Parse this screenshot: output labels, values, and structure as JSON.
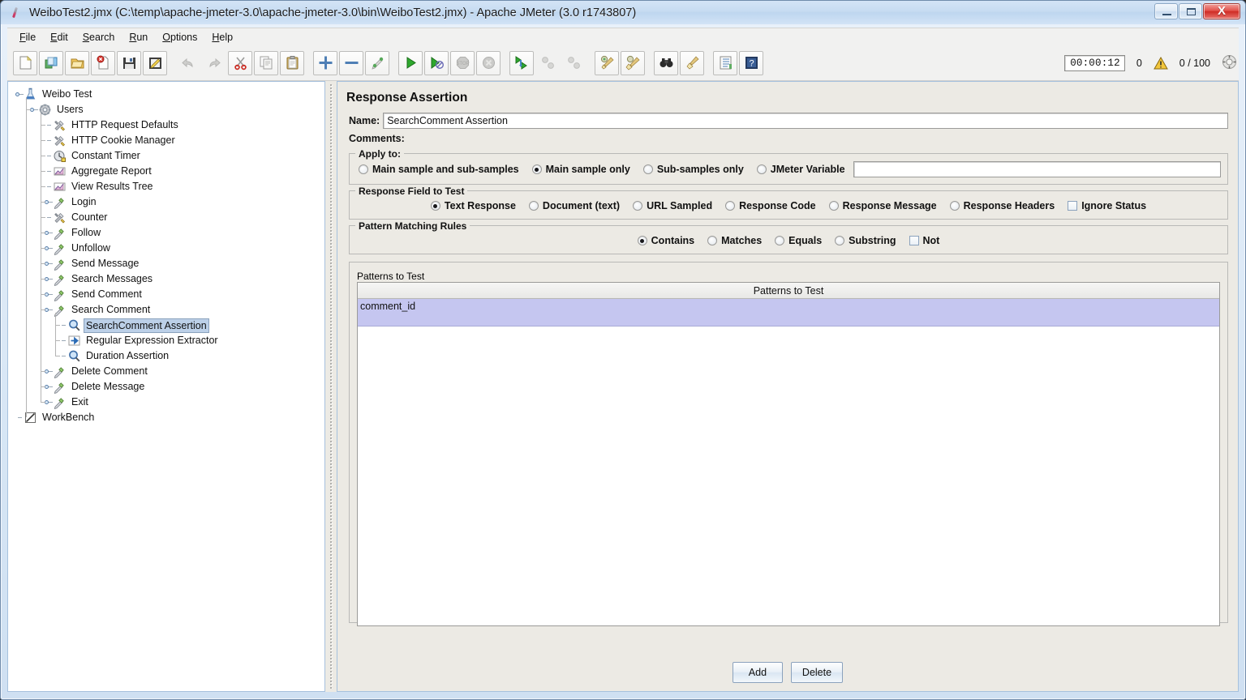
{
  "window": {
    "title": "WeiboTest2.jmx (C:\\temp\\apache-jmeter-3.0\\apache-jmeter-3.0\\bin\\WeiboTest2.jmx) - Apache JMeter (3.0 r1743807)",
    "app_icon": "flask-icon",
    "minimize_label": "",
    "maximize_label": "",
    "close_label": "X"
  },
  "menubar": {
    "items": [
      {
        "label": "File",
        "mnemonic": "F"
      },
      {
        "label": "Edit",
        "mnemonic": "E"
      },
      {
        "label": "Search",
        "mnemonic": "S"
      },
      {
        "label": "Run",
        "mnemonic": "R"
      },
      {
        "label": "Options",
        "mnemonic": "O"
      },
      {
        "label": "Help",
        "mnemonic": "H"
      }
    ]
  },
  "toolbar": {
    "buttons": [
      {
        "name": "new-button",
        "icon": "new-page-icon"
      },
      {
        "name": "templates-button",
        "icon": "templates-icon"
      },
      {
        "name": "open-button",
        "icon": "open-folder-icon"
      },
      {
        "name": "close-button",
        "icon": "close-page-icon"
      },
      {
        "name": "save-button",
        "icon": "floppy-disk-icon"
      },
      {
        "name": "save-as-button",
        "icon": "save-as-icon"
      },
      {
        "name": "undo-button",
        "icon": "undo-arrow-icon"
      },
      {
        "name": "redo-button",
        "icon": "redo-arrow-icon"
      },
      {
        "name": "cut-button",
        "icon": "scissors-icon"
      },
      {
        "name": "copy-button",
        "icon": "copy-pages-icon"
      },
      {
        "name": "paste-button",
        "icon": "clipboard-icon"
      },
      {
        "name": "expand-all-button",
        "icon": "plus-icon"
      },
      {
        "name": "collapse-all-button",
        "icon": "minus-icon"
      },
      {
        "name": "toggle-button",
        "icon": "toggle-pencil-icon"
      },
      {
        "name": "start-button",
        "icon": "play-green-icon"
      },
      {
        "name": "start-no-pauses-button",
        "icon": "play-no-pause-icon"
      },
      {
        "name": "stop-button",
        "icon": "stop-sign-icon"
      },
      {
        "name": "shutdown-button",
        "icon": "shutdown-x-icon"
      },
      {
        "name": "start-remote-all-button",
        "icon": "remote-start-icon"
      },
      {
        "name": "stop-remote-all-button",
        "icon": "remote-stop-icon"
      },
      {
        "name": "shutdown-remote-all-button",
        "icon": "remote-shutdown-icon"
      },
      {
        "name": "clear-button",
        "icon": "clear-broom-icon"
      },
      {
        "name": "clear-all-button",
        "icon": "clear-all-broom-icon"
      },
      {
        "name": "search-button",
        "icon": "binoculars-icon"
      },
      {
        "name": "reset-search-button",
        "icon": "reset-broom-icon"
      },
      {
        "name": "function-helper-button",
        "icon": "function-list-icon"
      },
      {
        "name": "help-button",
        "icon": "help-book-icon"
      }
    ],
    "status": {
      "elapsed_time": "00:00:12",
      "error_count": "0",
      "warning_icon": "warning-triangle-icon",
      "threads_running": "0 / 100",
      "thread_icon": "thread-gauge-icon"
    }
  },
  "tree": {
    "nodes": [
      {
        "label": "Weibo Test",
        "depth": 0,
        "icon": "test-plan-icon",
        "handle": "expanded",
        "selected": false
      },
      {
        "label": "Users",
        "depth": 1,
        "icon": "thread-group-icon",
        "handle": "expanded",
        "selected": false
      },
      {
        "label": "HTTP Request Defaults",
        "depth": 2,
        "icon": "config-tools-icon",
        "handle": "leaf",
        "selected": false
      },
      {
        "label": "HTTP Cookie Manager",
        "depth": 2,
        "icon": "config-tools-icon",
        "handle": "leaf",
        "selected": false
      },
      {
        "label": "Constant Timer",
        "depth": 2,
        "icon": "timer-clock-icon",
        "handle": "leaf",
        "selected": false
      },
      {
        "label": "Aggregate Report",
        "depth": 2,
        "icon": "listener-chart-icon",
        "handle": "leaf",
        "selected": false
      },
      {
        "label": "View Results Tree",
        "depth": 2,
        "icon": "listener-chart-icon",
        "handle": "leaf",
        "selected": false
      },
      {
        "label": "Login",
        "depth": 2,
        "icon": "sampler-pipette-icon",
        "handle": "collapsed",
        "selected": false
      },
      {
        "label": "Counter",
        "depth": 2,
        "icon": "config-tools-icon",
        "handle": "leaf",
        "selected": false
      },
      {
        "label": "Follow",
        "depth": 2,
        "icon": "sampler-pipette-icon",
        "handle": "collapsed",
        "selected": false
      },
      {
        "label": "Unfollow",
        "depth": 2,
        "icon": "sampler-pipette-icon",
        "handle": "collapsed",
        "selected": false
      },
      {
        "label": "Send Message",
        "depth": 2,
        "icon": "sampler-pipette-icon",
        "handle": "collapsed",
        "selected": false
      },
      {
        "label": "Search Messages",
        "depth": 2,
        "icon": "sampler-pipette-icon",
        "handle": "collapsed",
        "selected": false
      },
      {
        "label": "Send Comment",
        "depth": 2,
        "icon": "sampler-pipette-icon",
        "handle": "collapsed",
        "selected": false
      },
      {
        "label": "Search Comment",
        "depth": 2,
        "icon": "sampler-pipette-icon",
        "handle": "expanded",
        "selected": false
      },
      {
        "label": "SearchComment  Assertion",
        "depth": 3,
        "icon": "assertion-magnifier-icon",
        "handle": "leaf",
        "selected": true
      },
      {
        "label": "Regular Expression Extractor",
        "depth": 3,
        "icon": "post-processor-arrow-icon",
        "handle": "leaf",
        "selected": false
      },
      {
        "label": "Duration Assertion",
        "depth": 3,
        "icon": "assertion-magnifier-icon",
        "handle": "leaf",
        "selected": false
      },
      {
        "label": "Delete Comment",
        "depth": 2,
        "icon": "sampler-pipette-icon",
        "handle": "collapsed",
        "selected": false
      },
      {
        "label": "Delete Message",
        "depth": 2,
        "icon": "sampler-pipette-icon",
        "handle": "collapsed",
        "selected": false
      },
      {
        "label": "Exit",
        "depth": 2,
        "icon": "sampler-pipette-icon",
        "handle": "collapsed",
        "selected": false
      },
      {
        "label": "WorkBench",
        "depth": 0,
        "icon": "workbench-icon",
        "handle": "leaf",
        "selected": false
      }
    ]
  },
  "panel": {
    "title": "Response Assertion",
    "name_label": "Name:",
    "name_value": "SearchComment  Assertion",
    "comments_label": "Comments:",
    "comments_value": "",
    "apply_to": {
      "title": "Apply to:",
      "options": [
        {
          "label": "Main sample and sub-samples",
          "selected": false
        },
        {
          "label": "Main sample only",
          "selected": true
        },
        {
          "label": "Sub-samples only",
          "selected": false
        },
        {
          "label": "JMeter Variable",
          "selected": false
        }
      ],
      "variable_value": ""
    },
    "response_field": {
      "title": "Response Field to Test",
      "options": [
        {
          "label": "Text Response",
          "selected": true
        },
        {
          "label": "Document (text)",
          "selected": false
        },
        {
          "label": "URL Sampled",
          "selected": false
        },
        {
          "label": "Response Code",
          "selected": false
        },
        {
          "label": "Response Message",
          "selected": false
        },
        {
          "label": "Response Headers",
          "selected": false
        }
      ],
      "checkbox": {
        "label": "Ignore Status",
        "checked": false
      }
    },
    "pattern_rules": {
      "title": "Pattern Matching Rules",
      "options": [
        {
          "label": "Contains",
          "selected": true
        },
        {
          "label": "Matches",
          "selected": false
        },
        {
          "label": "Equals",
          "selected": false
        },
        {
          "label": "Substring",
          "selected": false
        }
      ],
      "checkbox": {
        "label": "Not",
        "checked": false
      }
    },
    "patterns": {
      "title": "Patterns to Test",
      "column_header": "Patterns to Test",
      "rows": [
        "comment_id"
      ],
      "add_label": "Add",
      "delete_label": "Delete"
    }
  },
  "colors": {
    "selection_row": "#c5c6f0",
    "tree_selection": "#bcd0e8",
    "title_bar": "#c6dbf1",
    "panel_bg": "#eceae4",
    "close_button": "#cf2d26"
  }
}
